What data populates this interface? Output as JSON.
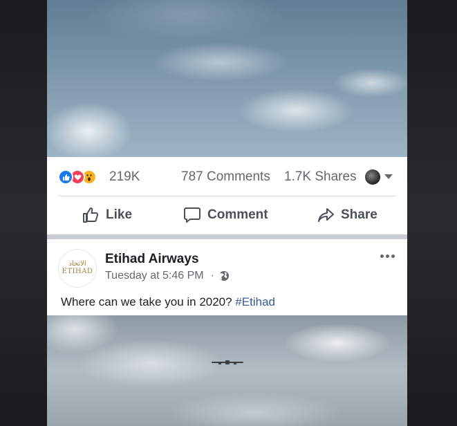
{
  "stats": {
    "reactions_count": "219K",
    "comments_count": "787 Comments",
    "shares_count": "1.7K Shares"
  },
  "actions": {
    "like_label": "Like",
    "comment_label": "Comment",
    "share_label": "Share"
  },
  "post": {
    "page_name": "Etihad Airways",
    "timestamp": "Tuesday at 5:46 PM",
    "dot": "·",
    "caption_text": "Where can we take you in 2020?",
    "caption_hashtag": "#Etihad",
    "logo_arabic": "الاتحاد",
    "logo_text": "ETIHAD"
  },
  "icons": {
    "reactions": [
      "like-reaction-icon",
      "love-reaction-icon",
      "wow-reaction-icon"
    ],
    "globe": "globe-icon",
    "more": "more-options-icon"
  },
  "colors": {
    "facebook_blue": "#1877f2",
    "love_red": "#f33e58",
    "wow_yellow": "#f7b125",
    "hashtag": "#385898",
    "etihad_gold": "#a6803b"
  }
}
